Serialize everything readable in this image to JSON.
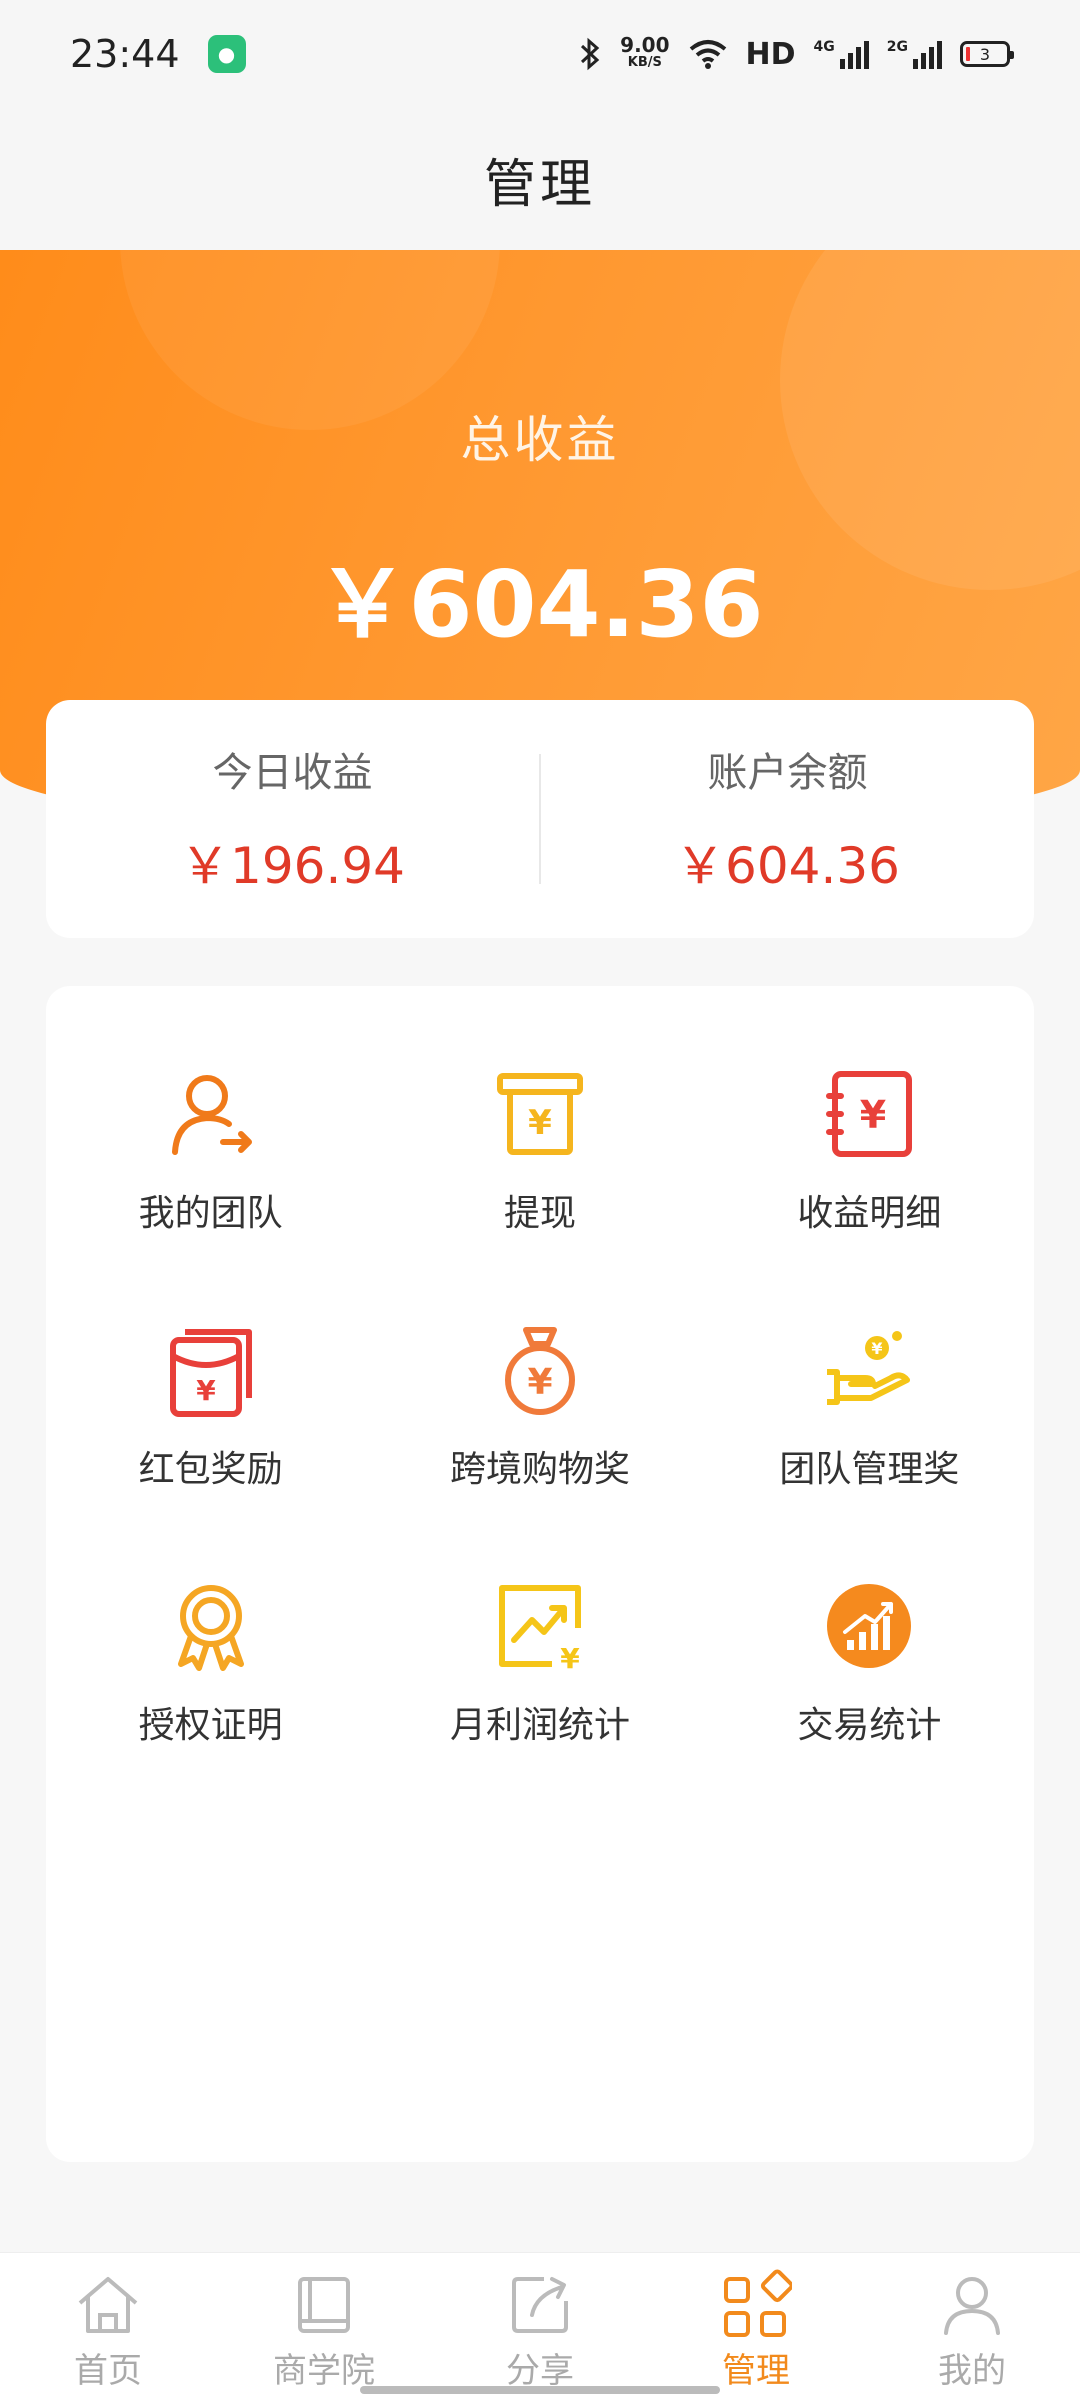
{
  "status_bar": {
    "time": "23:44",
    "net_speed_value": "9.00",
    "net_speed_unit": "KB/S",
    "hd": "HD",
    "sig1": "4G",
    "sig2": "2G",
    "battery": "3"
  },
  "nav": {
    "title": "管理"
  },
  "banner": {
    "total_label": "总收益",
    "total_value": "￥604.36"
  },
  "summary": {
    "today_label": "今日收益",
    "today_value": "￥196.94",
    "balance_label": "账户余额",
    "balance_value": "￥604.36"
  },
  "grid": {
    "items": [
      {
        "label": "我的团队",
        "icon": "team-icon"
      },
      {
        "label": "提现",
        "icon": "withdraw-icon"
      },
      {
        "label": "收益明细",
        "icon": "earnings-detail-icon"
      },
      {
        "label": "红包奖励",
        "icon": "red-envelope-icon"
      },
      {
        "label": "跨境购物奖",
        "icon": "money-bag-icon"
      },
      {
        "label": "团队管理奖",
        "icon": "hand-coin-icon"
      },
      {
        "label": "授权证明",
        "icon": "award-ribbon-icon"
      },
      {
        "label": "月利润统计",
        "icon": "profit-chart-icon"
      },
      {
        "label": "交易统计",
        "icon": "trade-stats-icon"
      }
    ]
  },
  "tabs": [
    {
      "label": "首页",
      "icon": "home-icon"
    },
    {
      "label": "商学院",
      "icon": "book-icon"
    },
    {
      "label": "分享",
      "icon": "share-icon"
    },
    {
      "label": "管理",
      "icon": "manage-icon",
      "active": true
    },
    {
      "label": "我的",
      "icon": "user-icon"
    }
  ],
  "colors": {
    "brand_orange": "#ff8c1a",
    "amount_red": "#e03a28",
    "active_tab": "#f28a1c"
  }
}
